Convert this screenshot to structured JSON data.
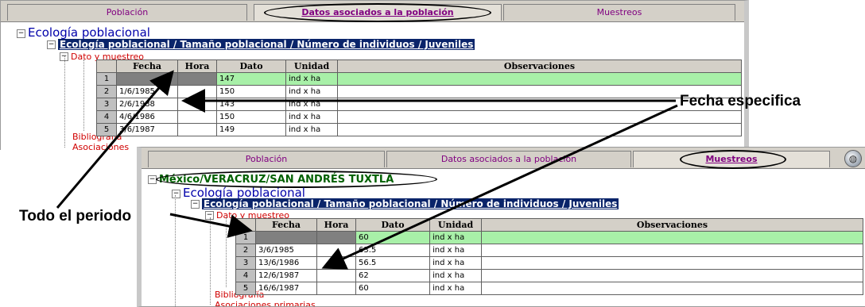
{
  "panel1": {
    "tabs": [
      {
        "label": "Población",
        "active": false
      },
      {
        "label": "Datos asociados a la población",
        "active": true
      },
      {
        "label": "Muestreos",
        "active": false
      }
    ],
    "tree": {
      "root": "Ecología poblacional",
      "path": "Ecología poblacional / Tamaño poblacional / Número de individuos / Juveniles",
      "data_node": "Dato y muestreo",
      "bibliography": "Bibliografía",
      "associations": "Asociaciones"
    },
    "table": {
      "columns": [
        "Fecha",
        "Hora",
        "Dato",
        "Unidad",
        "Observaciones"
      ],
      "rows": [
        {
          "n": "1",
          "fecha": "",
          "hora": "",
          "dato": "147",
          "unidad": "ind x ha",
          "obs": ""
        },
        {
          "n": "2",
          "fecha": "1/6/1985",
          "hora": "",
          "dato": "150",
          "unidad": "ind x ha",
          "obs": ""
        },
        {
          "n": "3",
          "fecha": "2/6/1988",
          "hora": "",
          "dato": "143",
          "unidad": "ind x ha",
          "obs": ""
        },
        {
          "n": "4",
          "fecha": "4/6/1986",
          "hora": "",
          "dato": "150",
          "unidad": "ind x ha",
          "obs": ""
        },
        {
          "n": "5",
          "fecha": "3/6/1987",
          "hora": "",
          "dato": "149",
          "unidad": "ind x ha",
          "obs": ""
        }
      ]
    }
  },
  "panel2": {
    "tabs": [
      {
        "label": "Población",
        "active": false
      },
      {
        "label": "Datos asociados a la población",
        "active": false
      },
      {
        "label": "Muestreos",
        "active": true
      }
    ],
    "tree": {
      "location": "México/VERACRUZ/SAN ANDRÉS TUXTLA",
      "root": "Ecología poblacional",
      "path": "Ecología poblacional / Tamaño poblacional / Número de individuos / Juveniles",
      "data_node": "Dato y muestreo",
      "bibliography": "Bibliografía",
      "associations": "Asociaciones primarias"
    },
    "table": {
      "columns": [
        "Fecha",
        "Hora",
        "Dato",
        "Unidad",
        "Observaciones"
      ],
      "rows": [
        {
          "n": "1",
          "fecha": "",
          "hora": "",
          "dato": "60",
          "unidad": "ind x ha",
          "obs": ""
        },
        {
          "n": "2",
          "fecha": "3/6/1985",
          "hora": "",
          "dato": "63.5",
          "unidad": "ind x ha",
          "obs": ""
        },
        {
          "n": "3",
          "fecha": "13/6/1986",
          "hora": "",
          "dato": "56.5",
          "unidad": "ind x ha",
          "obs": ""
        },
        {
          "n": "4",
          "fecha": "12/6/1987",
          "hora": "",
          "dato": "62",
          "unidad": "ind x ha",
          "obs": ""
        },
        {
          "n": "5",
          "fecha": "16/6/1987",
          "hora": "",
          "dato": "60",
          "unidad": "ind x ha",
          "obs": ""
        }
      ]
    }
  },
  "annotations": {
    "fecha_especifica": "Fecha especifica",
    "todo_el_periodo": "Todo el periodo"
  },
  "colors": {
    "tab_text": "#800080",
    "selection_bg": "#0a246a",
    "highlight_row": "#a8f0a8",
    "root_text": "#0000aa",
    "red_text": "#d00000"
  }
}
